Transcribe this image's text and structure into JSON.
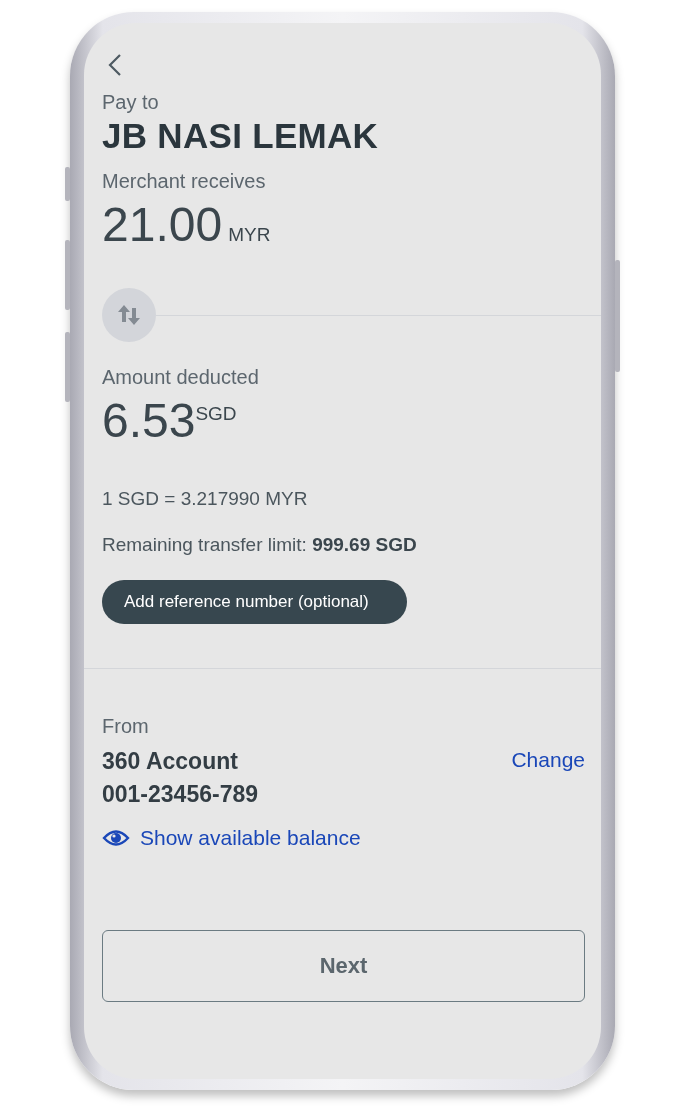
{
  "pay_to": {
    "label": "Pay to",
    "merchant": "JB NASI LEMAK"
  },
  "merchant_receives": {
    "label": "Merchant receives",
    "amount": "21.00",
    "currency": "MYR"
  },
  "amount_deducted": {
    "label": "Amount deducted",
    "amount": "6.53",
    "currency": "SGD"
  },
  "exchange_rate": "1 SGD = 3.217990 MYR",
  "transfer_limit": "Remaining transfer limit: **999.69 SGD**",
  "reference_button": "Add reference number (optional)",
  "from": {
    "label": "From",
    "account_name": "360 Account",
    "account_number": "001-23456-789",
    "change_link": "Change",
    "balance_link": "Show available balance"
  },
  "next_button": "Next"
}
